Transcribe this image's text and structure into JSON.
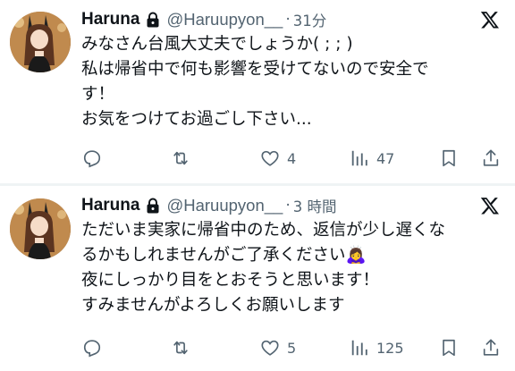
{
  "tweets": [
    {
      "display_name": "Haruna",
      "handle": "@Haruupyon__",
      "separator": "·",
      "time": "31分",
      "lines": [
        "みなさん台風大丈夫でしょうか( ; ; )",
        "私は帰省中で何も影響を受けてないので安全で",
        "す！",
        "お気をつけてお過ごし下さい..."
      ],
      "likes": "4",
      "views": "47"
    },
    {
      "display_name": "Haruna",
      "handle": "@Haruupyon__",
      "separator": "·",
      "time": "3 時間",
      "lines": [
        "ただいま実家に帰省中のため、返信が少し遅くな",
        "るかもしれませんがご了承ください🙇‍♀️",
        "夜にしっかり目をとおそうと思います！",
        "すみませんがよろしくお願いします"
      ],
      "likes": "5",
      "views": "125"
    }
  ],
  "icons": [
    "avatar",
    "lock-icon",
    "x-logo-icon",
    "reply-icon",
    "retweet-icon",
    "like-icon",
    "views-icon",
    "bookmark-icon",
    "share-icon"
  ],
  "colors": {
    "text": "#0f1419",
    "secondary": "#536471",
    "divider": "#eff3f4"
  }
}
